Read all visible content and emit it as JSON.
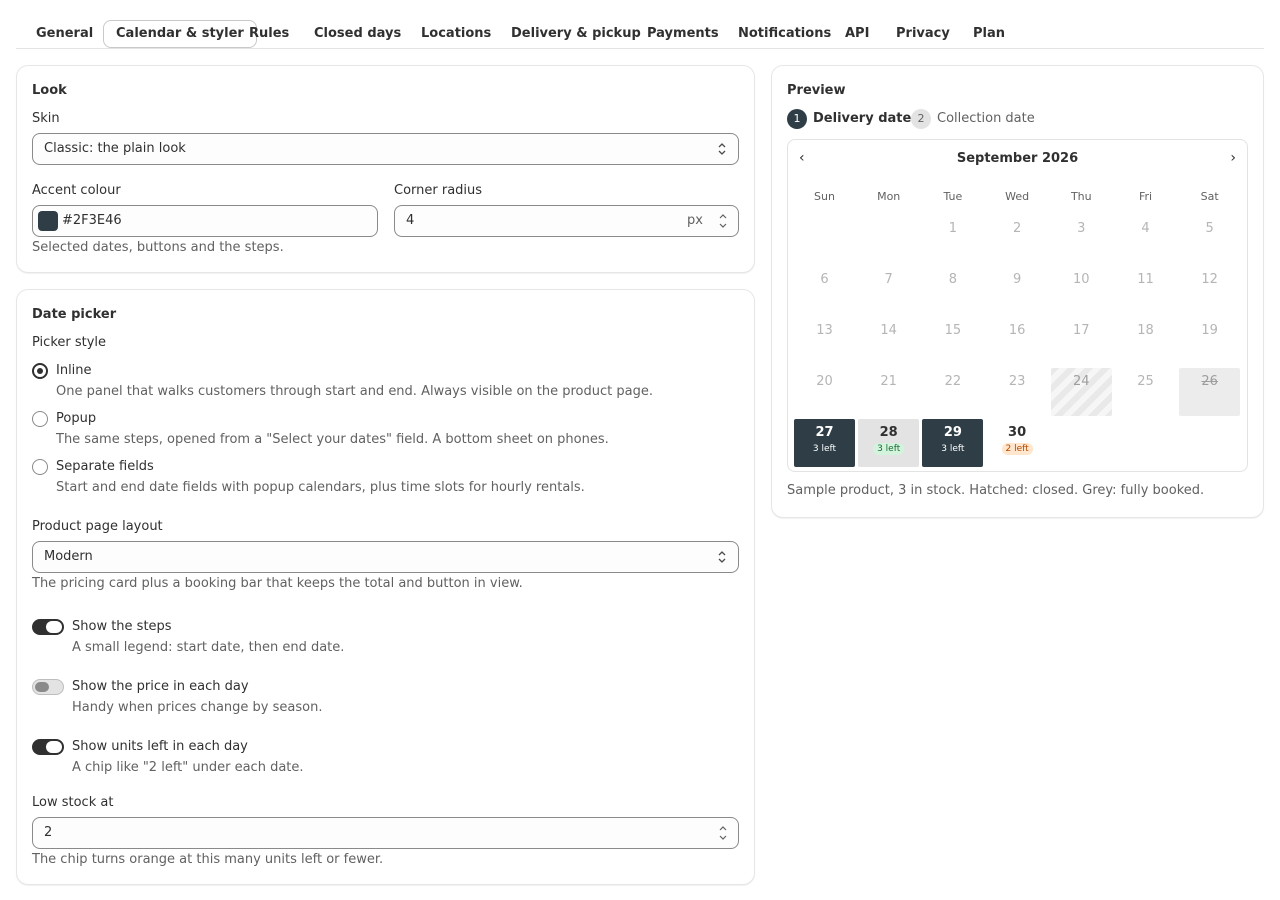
{
  "tabs": [
    "General",
    "Calendar & styler",
    "Rules",
    "Closed days",
    "Locations",
    "Delivery & pickup",
    "Payments",
    "Notifications",
    "API",
    "Privacy",
    "Plan"
  ],
  "active_tab": "Calendar & styler",
  "look": {
    "title": "Look",
    "skin_label": "Skin",
    "skin_value": "Classic: the plain look",
    "accent_label": "Accent colour",
    "accent_value": "#2F3E46",
    "radius_label": "Corner radius",
    "radius_value": "4",
    "radius_suffix": "px",
    "help": "Selected dates, buttons and the steps."
  },
  "date_picker": {
    "title": "Date picker",
    "picker_style_label": "Picker style",
    "options": [
      {
        "label": "Inline",
        "help": "One panel that walks customers through start and end. Always visible on the product page.",
        "selected": true
      },
      {
        "label": "Popup",
        "help": "The same steps, opened from a \"Select your dates\" field. A bottom sheet on phones.",
        "selected": false
      },
      {
        "label": "Separate fields",
        "help": "Start and end date fields with popup calendars, plus time slots for hourly rentals.",
        "selected": false
      }
    ],
    "layout_label": "Product page layout",
    "layout_value": "Modern",
    "layout_help": "The pricing card plus a booking bar that keeps the total and button in view.",
    "toggles": [
      {
        "label": "Show the steps",
        "help": "A small legend: start date, then end date.",
        "on": true
      },
      {
        "label": "Show the price in each day",
        "help": "Handy when prices change by season.",
        "on": false
      },
      {
        "label": "Show units left in each day",
        "help": "A chip like \"2 left\" under each date.",
        "on": true
      }
    ],
    "low_stock_label": "Low stock at",
    "low_stock_value": "2",
    "low_stock_help": "The chip turns orange at this many units left or fewer."
  },
  "preview": {
    "title": "Preview",
    "steps": [
      {
        "num": "1",
        "label": "Delivery date"
      },
      {
        "num": "2",
        "label": "Collection date"
      }
    ],
    "prev": "‹",
    "next": "›",
    "month": "September 2026",
    "weekdays": [
      "Sun",
      "Mon",
      "Tue",
      "Wed",
      "Thu",
      "Fri",
      "Sat"
    ],
    "first_weekday": 2,
    "days": [
      {
        "d": "1",
        "state": "past"
      },
      {
        "d": "2",
        "state": "past"
      },
      {
        "d": "3",
        "state": "past"
      },
      {
        "d": "4",
        "state": "past"
      },
      {
        "d": "5",
        "state": "past"
      },
      {
        "d": "6",
        "state": "past"
      },
      {
        "d": "7",
        "state": "past"
      },
      {
        "d": "8",
        "state": "past"
      },
      {
        "d": "9",
        "state": "past"
      },
      {
        "d": "10",
        "state": "past"
      },
      {
        "d": "11",
        "state": "past"
      },
      {
        "d": "12",
        "state": "past"
      },
      {
        "d": "13",
        "state": "past"
      },
      {
        "d": "14",
        "state": "past"
      },
      {
        "d": "15",
        "state": "past"
      },
      {
        "d": "16",
        "state": "past"
      },
      {
        "d": "17",
        "state": "past"
      },
      {
        "d": "18",
        "state": "past"
      },
      {
        "d": "19",
        "state": "past"
      },
      {
        "d": "20",
        "state": "past"
      },
      {
        "d": "21",
        "state": "past"
      },
      {
        "d": "22",
        "state": "past"
      },
      {
        "d": "23",
        "state": "past"
      },
      {
        "d": "24",
        "state": "hatched"
      },
      {
        "d": "25",
        "state": "past"
      },
      {
        "d": "26",
        "state": "booked"
      },
      {
        "d": "27",
        "state": "selected",
        "chip": "3 left",
        "chip_style": "dark"
      },
      {
        "d": "28",
        "state": "range",
        "chip": "3 left",
        "chip_style": "green"
      },
      {
        "d": "29",
        "state": "selected",
        "chip": "3 left",
        "chip_style": "dark"
      },
      {
        "d": "30",
        "state": "normal",
        "chip": "2 left",
        "chip_style": "orange"
      }
    ],
    "caption": "Sample product, 3 in stock. Hatched: closed. Grey: fully booked."
  },
  "colors": {
    "accent": "#2F3E46"
  }
}
